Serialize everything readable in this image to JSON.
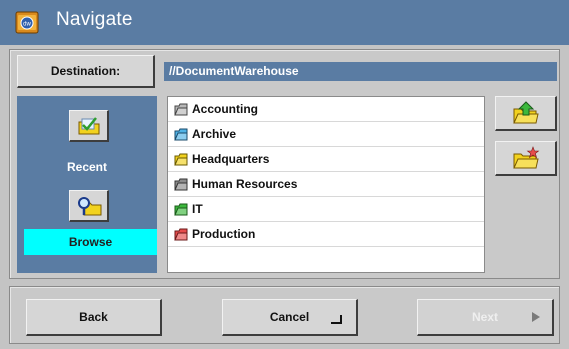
{
  "window": {
    "title": "Navigate",
    "icon": "document-warehouse-app-icon"
  },
  "destination": {
    "button_label": "Destination:",
    "path": "//DocumentWarehouse"
  },
  "left_nav": {
    "recent": {
      "label": "Recent",
      "icon": "recent-folder-check-icon"
    },
    "browse": {
      "label": "Browse",
      "icon": "browse-folder-magnifier-icon",
      "selected": true
    }
  },
  "folders": [
    {
      "name": "Accounting",
      "color": "#b8b8b8"
    },
    {
      "name": "Archive",
      "color": "#4fb3e6"
    },
    {
      "name": "Headquarters",
      "color": "#f2d21e"
    },
    {
      "name": "Human Resources",
      "color": "#8c8c8c"
    },
    {
      "name": "IT",
      "color": "#3cb83c"
    },
    {
      "name": "Production",
      "color": "#e64c4c"
    }
  ],
  "side_actions": {
    "up": {
      "icon": "folder-up-icon"
    },
    "new": {
      "icon": "new-folder-icon"
    }
  },
  "footer": {
    "back_label": "Back",
    "cancel_label": "Cancel",
    "next_label": "Next",
    "next_enabled": false
  },
  "colors": {
    "titlebar": "#5a7ca3",
    "selection": "#00ffff",
    "panel": "#c9c9c9"
  }
}
